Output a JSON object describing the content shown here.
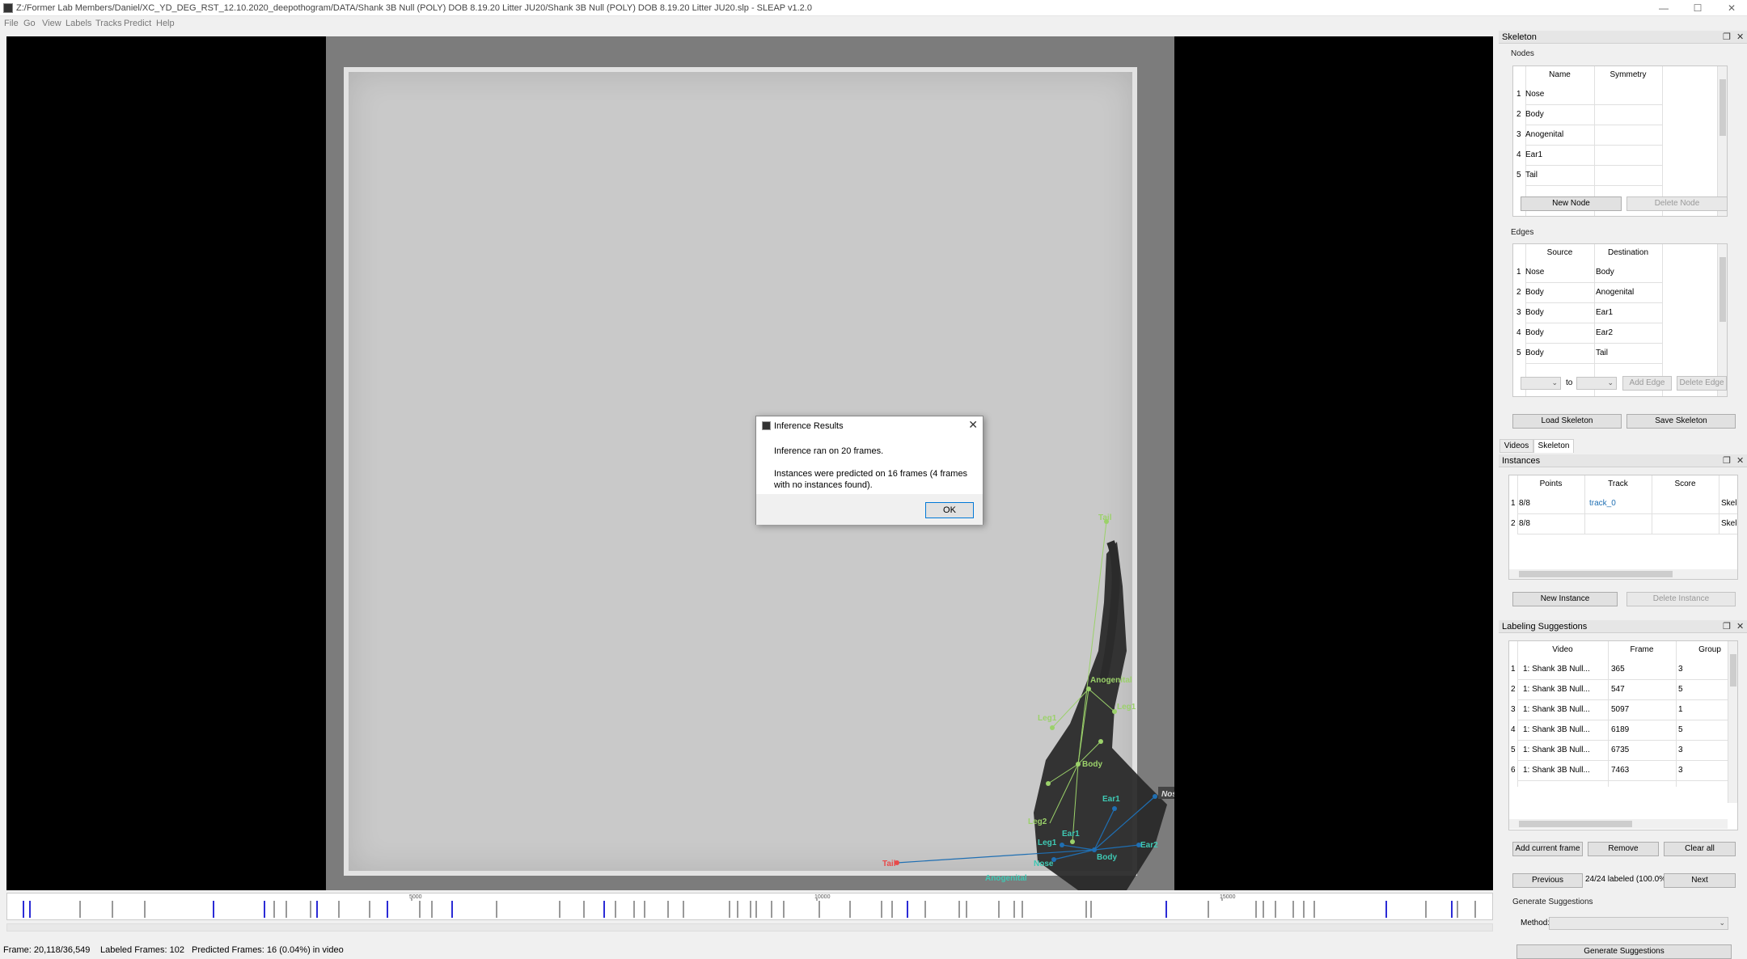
{
  "titlebar": {
    "title": "Z:/Former Lab Members/Daniel/XC_YD_DEG_RST_12.10.2020_deepothogram/DATA/Shank 3B Null (POLY) DOB 8.19.20 Litter JU20/Shank 3B Null (POLY) DOB 8.19.20 Litter JU20.slp - SLEAP v1.2.0",
    "minimize": "—",
    "maximize": "☐",
    "close": "✕"
  },
  "menu": [
    "File",
    "Go",
    "View",
    "Labels",
    "Tracks",
    "Predict",
    "Help"
  ],
  "dialog": {
    "title": "Inference Results",
    "message1": "Inference ran on 20 frames.",
    "message2": "Instances were predicted on 16 frames (4 frames with no instances found).",
    "ok": "OK"
  },
  "overlay": {
    "labels": {
      "tail_top": "Tail",
      "anogenital1": "Anogenital",
      "leg1a": "Leg1",
      "leg2a": "Leg1",
      "body1": "Body",
      "ear1a": "Ear1",
      "leg2b": "Leg2",
      "leg1b": "Leg1",
      "nose1": "Nose",
      "tail_red": "Tail",
      "anogenital2": "Anogenital",
      "body2": "Body",
      "ear2b": "Ear2",
      "ear1b": "Ear1",
      "nose2": "Nose"
    }
  },
  "timeline": {
    "ticks": [
      "5000",
      "10000",
      "15000"
    ]
  },
  "status": {
    "frame": "Frame: 20,118/36,549",
    "labeled": "Labeled Frames: 102",
    "predicted": "Predicted Frames: 16 (0.04%) in video"
  },
  "skeleton_panel": {
    "title": "Skeleton",
    "nodes_label": "Nodes",
    "nodes_headers": [
      "Name",
      "Symmetry"
    ],
    "nodes": [
      {
        "n": "1",
        "name": "Nose",
        "sym": ""
      },
      {
        "n": "2",
        "name": "Body",
        "sym": ""
      },
      {
        "n": "3",
        "name": "Anogenital",
        "sym": ""
      },
      {
        "n": "4",
        "name": "Ear1",
        "sym": ""
      },
      {
        "n": "5",
        "name": "Tail",
        "sym": ""
      }
    ],
    "new_node": "New Node",
    "delete_node": "Delete Node",
    "edges_label": "Edges",
    "edges_headers": [
      "Source",
      "Destination"
    ],
    "edges": [
      {
        "n": "1",
        "src": "Nose",
        "dst": "Body"
      },
      {
        "n": "2",
        "src": "Body",
        "dst": "Anogenital"
      },
      {
        "n": "3",
        "src": "Body",
        "dst": "Ear1"
      },
      {
        "n": "4",
        "src": "Body",
        "dst": "Ear2"
      },
      {
        "n": "5",
        "src": "Body",
        "dst": "Tail"
      }
    ],
    "to_label": "to",
    "add_edge": "Add Edge",
    "delete_edge": "Delete Edge",
    "load_skeleton": "Load Skeleton",
    "save_skeleton": "Save Skeleton",
    "tabs": [
      "Videos",
      "Skeleton"
    ]
  },
  "instances_panel": {
    "title": "Instances",
    "headers": [
      "Points",
      "Track",
      "Score",
      "Skel"
    ],
    "rows": [
      {
        "n": "1",
        "points": "8/8",
        "track": "track_0",
        "score": "",
        "skel": "Skele"
      },
      {
        "n": "2",
        "points": "8/8",
        "track": "",
        "score": "",
        "skel": "Skele"
      }
    ],
    "new_instance": "New Instance",
    "delete_instance": "Delete Instance"
  },
  "suggestions_panel": {
    "title": "Labeling Suggestions",
    "headers": [
      "Video",
      "Frame",
      "Group"
    ],
    "rows": [
      {
        "n": "1",
        "video": "1: Shank 3B Null...",
        "frame": "365",
        "group": "3"
      },
      {
        "n": "2",
        "video": "1: Shank 3B Null...",
        "frame": "547",
        "group": "5"
      },
      {
        "n": "3",
        "video": "1: Shank 3B Null...",
        "frame": "5097",
        "group": "1"
      },
      {
        "n": "4",
        "video": "1: Shank 3B Null...",
        "frame": "6189",
        "group": "5"
      },
      {
        "n": "5",
        "video": "1: Shank 3B Null...",
        "frame": "6735",
        "group": "3"
      },
      {
        "n": "6",
        "video": "1: Shank 3B Null...",
        "frame": "7463",
        "group": "3"
      }
    ],
    "add_current": "Add current frame",
    "remove": "Remove",
    "clear_all": "Clear all",
    "previous": "Previous",
    "labeled_status": "24/24 labeled (100.0%)",
    "next": "Next",
    "generate_label": "Generate Suggestions",
    "method_label": "Method:",
    "generate_button": "Generate Suggestions"
  },
  "colors": {
    "predicted": "#9bd16a",
    "user_label": "#3fc9b4",
    "edge_blue": "#1f6fb3",
    "missing": "#e84a4a",
    "timeline_mark": "#2b2bd6"
  }
}
